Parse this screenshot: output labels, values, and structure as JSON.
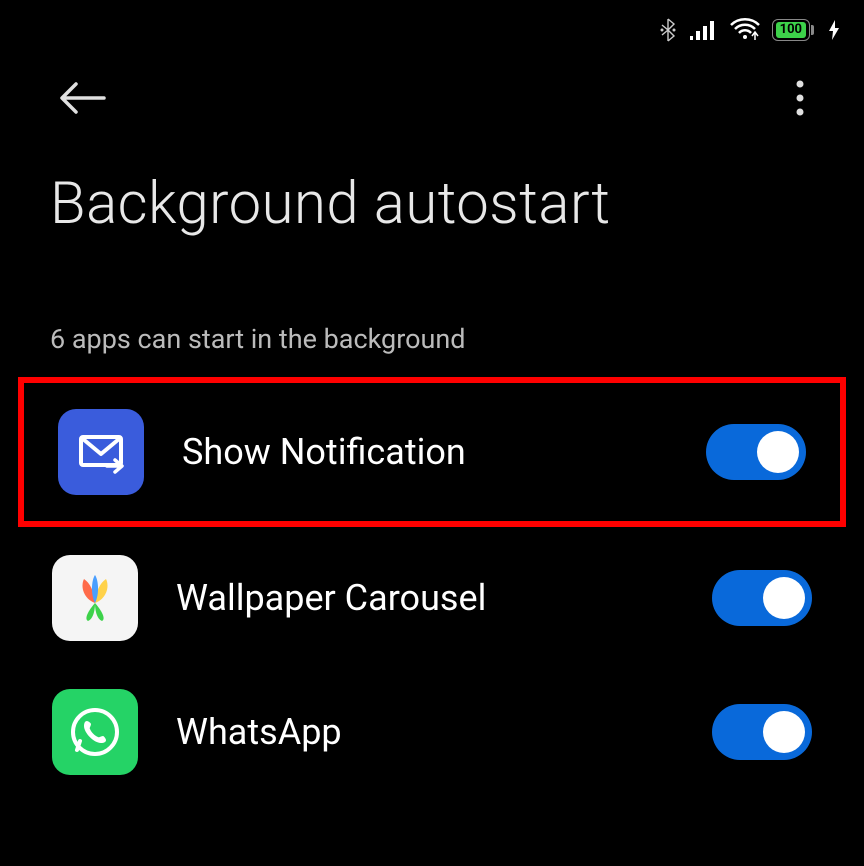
{
  "status": {
    "battery": "100"
  },
  "page": {
    "title": "Background autostart",
    "subtitle": "6 apps can start in the background"
  },
  "apps": [
    {
      "label": "Show Notification",
      "toggle": true,
      "highlighted": true
    },
    {
      "label": "Wallpaper Carousel",
      "toggle": true,
      "highlighted": false
    },
    {
      "label": "WhatsApp",
      "toggle": true,
      "highlighted": false
    }
  ]
}
